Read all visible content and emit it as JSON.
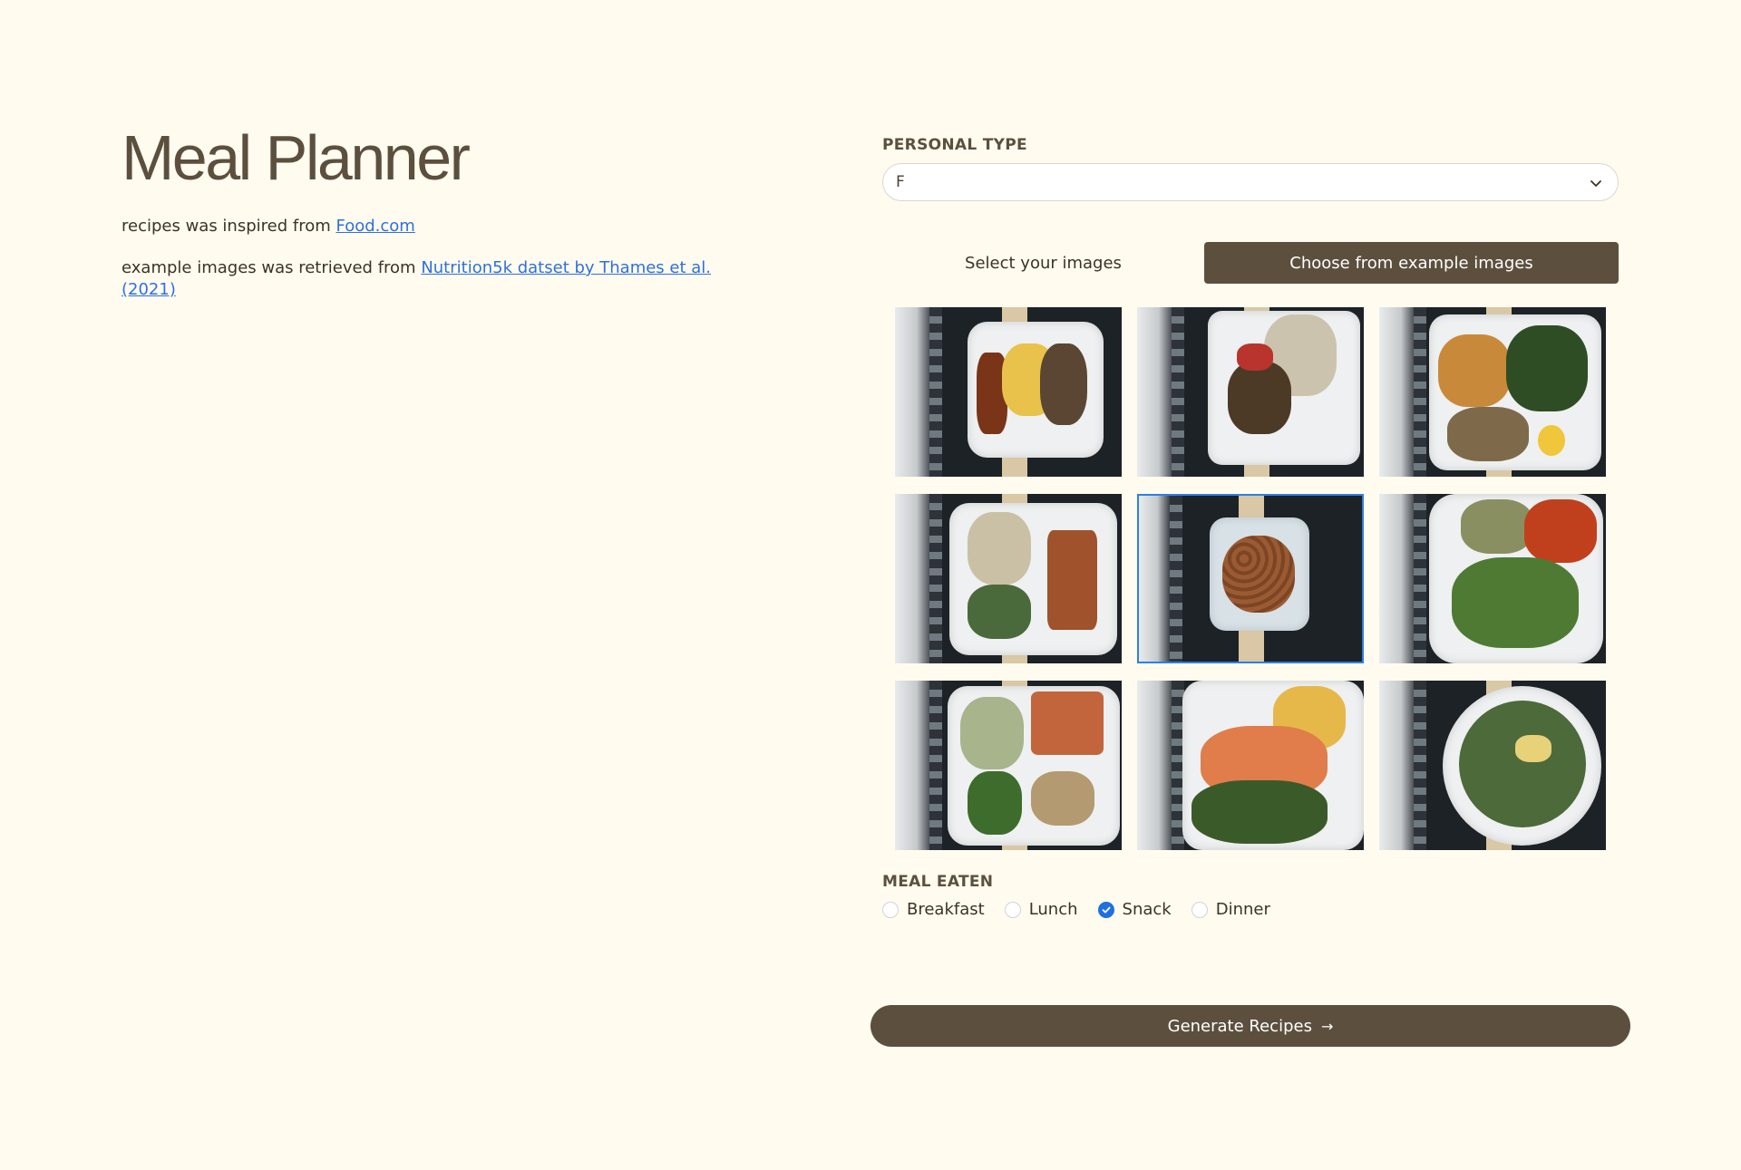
{
  "header": {
    "title": "Meal Planner",
    "credit1_prefix": "recipes was inspired from ",
    "credit1_link": "Food.com",
    "credit2_prefix": "example images was retrieved from ",
    "credit2_link": "Nutrition5k datset by Thames et al. (2021)"
  },
  "personal_type": {
    "label": "PERSONAL TYPE",
    "value": "F"
  },
  "image_source": {
    "tab_upload": "Select your images",
    "tab_examples": "Choose from example images",
    "active_tab": "Choose from example images"
  },
  "gallery": {
    "selected_index": 4,
    "count": 9
  },
  "meal": {
    "label": "MEAL EATEN",
    "options": [
      "Breakfast",
      "Lunch",
      "Snack",
      "Dinner"
    ],
    "selected": "Snack"
  },
  "actions": {
    "generate_label": "Generate Recipes",
    "generate_icon": "arrow-right-icon"
  },
  "colors": {
    "background": "#fffcef",
    "brand": "#5c4f3e",
    "link": "#2f6fe0",
    "selected": "#1f6fe0"
  }
}
